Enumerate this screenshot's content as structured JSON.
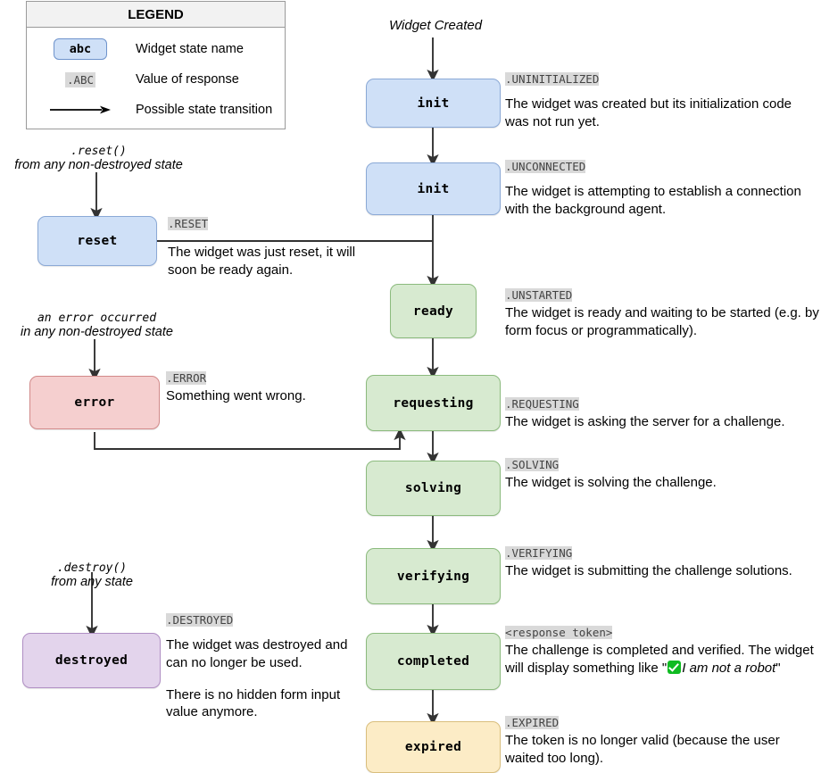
{
  "legend": {
    "title": "LEGEND",
    "rows": [
      {
        "key": "abc",
        "label": "Widget state name"
      },
      {
        "key": ".ABC",
        "label": "Value of response"
      },
      {
        "key": "arrow-icon",
        "label": "Possible state transition"
      }
    ]
  },
  "entry_label": "Widget Created",
  "triggers": [
    {
      "mono": ".reset()",
      "sub": "from any non-destroyed state"
    },
    {
      "mono": "an error occurred",
      "sub": "in any non-destroyed state"
    },
    {
      "mono": ".destroy()",
      "sub": "from any state"
    }
  ],
  "states": [
    {
      "id": "init-uninitialized",
      "name": "init",
      "color": "blue",
      "tag": ".UNINITIALIZED",
      "desc": "The widget was created but its initialization code was not run yet."
    },
    {
      "id": "init-unconnected",
      "name": "init",
      "color": "blue",
      "tag": ".UNCONNECTED",
      "desc": "The widget is attempting to establish a connection with the background agent."
    },
    {
      "id": "reset",
      "name": "reset",
      "color": "blue",
      "tag": ".RESET",
      "desc": "The widget was just reset, it will soon be ready again."
    },
    {
      "id": "ready",
      "name": "ready",
      "color": "green",
      "tag": ".UNSTARTED",
      "desc": "The widget is ready and waiting to be started (e.g. by form focus or programmatically)."
    },
    {
      "id": "error",
      "name": "error",
      "color": "red",
      "tag": ".ERROR",
      "desc": "Something went wrong."
    },
    {
      "id": "requesting",
      "name": "requesting",
      "color": "green",
      "tag": ".REQUESTING",
      "desc": "The widget is asking the server for a challenge."
    },
    {
      "id": "solving",
      "name": "solving",
      "color": "green",
      "tag": ".SOLVING",
      "desc": "The widget is solving the challenge."
    },
    {
      "id": "verifying",
      "name": "verifying",
      "color": "green",
      "tag": ".VERIFYING",
      "desc": "The widget is submitting the challenge solutions."
    },
    {
      "id": "destroyed",
      "name": "destroyed",
      "color": "purple",
      "tag": ".DESTROYED",
      "desc": "The widget was destroyed and can no longer be used.",
      "desc2": "There is no hidden form input value anymore."
    },
    {
      "id": "completed",
      "name": "completed",
      "color": "green",
      "tag": "<response token>",
      "desc_before": "The challenge is completed and verified. The widget will display something like \"",
      "desc_emoji": "white-check-mark-icon",
      "desc_italic": "I am not a robot",
      "desc_after": "\""
    },
    {
      "id": "expired",
      "name": "expired",
      "color": "yellow",
      "tag": ".EXPIRED",
      "desc": "The token is no longer valid (because the user waited too long)."
    }
  ],
  "colors": {
    "blue_fill": "#cfe0f7",
    "green_fill": "#d7ead0",
    "red_fill": "#f5cfcf",
    "purple_fill": "#e3d4ec",
    "yellow_fill": "#fcecc6",
    "tag_bg": "#d9d9d9",
    "edge": "#333333",
    "check_green": "#0fbb22"
  }
}
